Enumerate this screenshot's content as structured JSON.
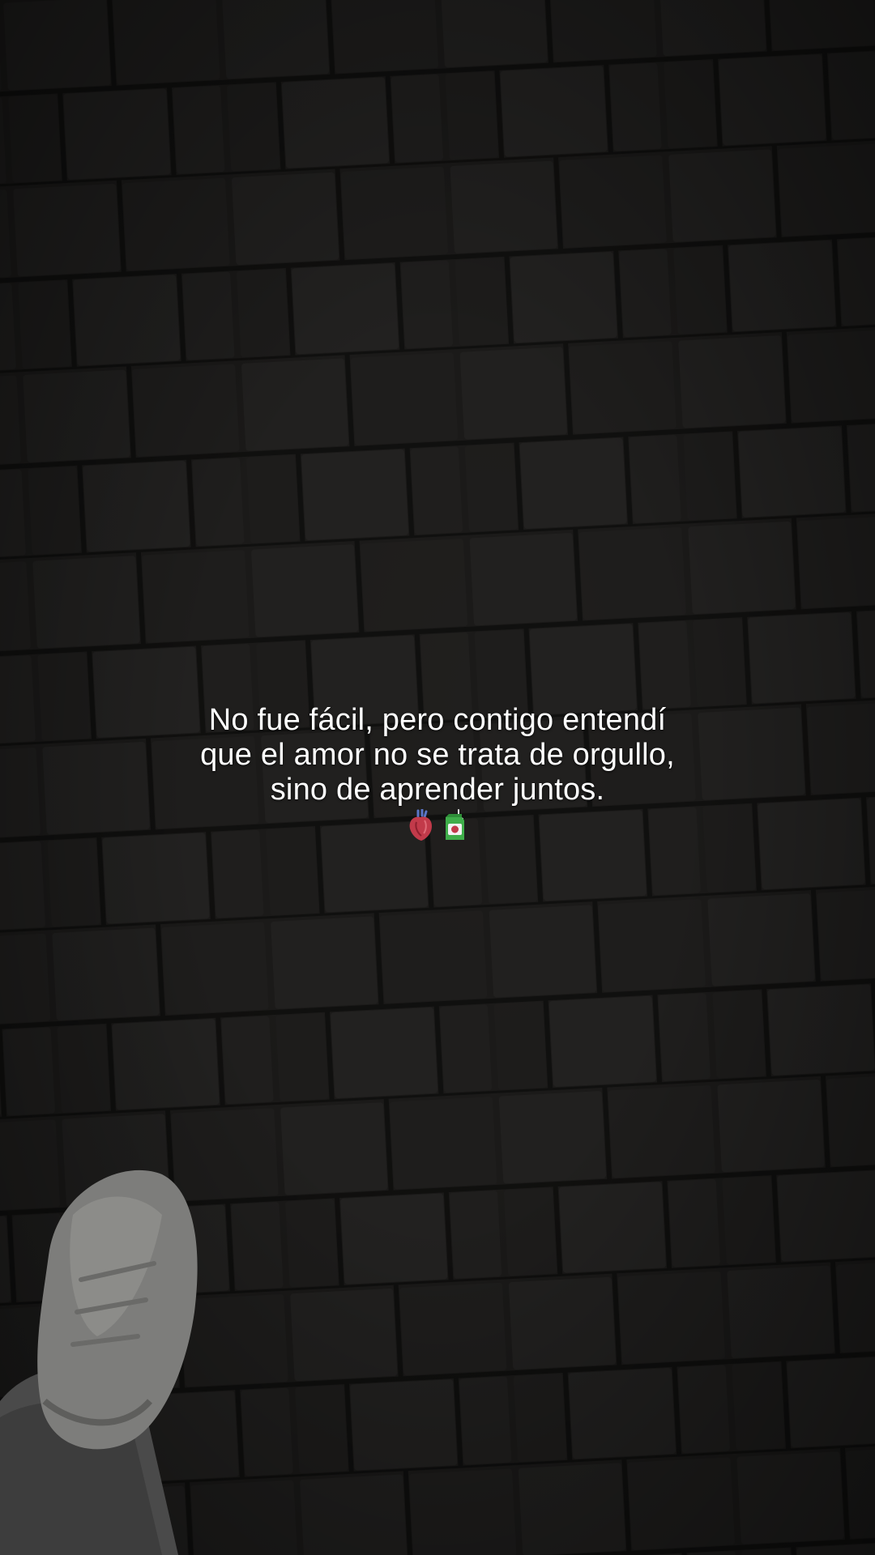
{
  "caption": {
    "line1": "No fue fácil, pero contigo entendí",
    "line2": "que el amor no se trata de orgullo,",
    "line3": "sino de aprender juntos."
  },
  "emojis": [
    "anatomical-heart-icon",
    "juice-box-icon"
  ],
  "colors": {
    "background": "#171615",
    "text": "#ffffff",
    "heart": "#c23a4a",
    "juice_box": "#3fae4a"
  }
}
